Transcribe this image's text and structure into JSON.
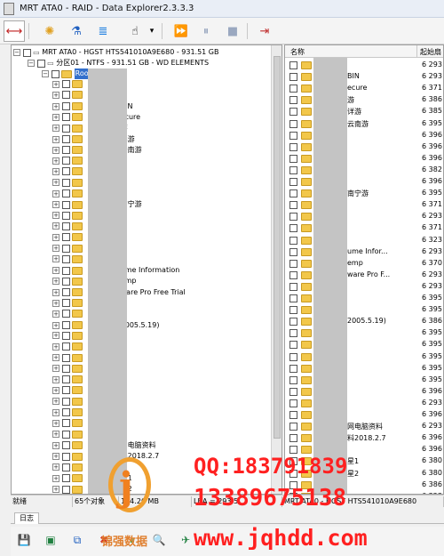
{
  "window": {
    "title": "MRT ATA0 - RAID - Data Explorer2.3.3.3"
  },
  "toolbar": {
    "buttons": [
      "connect-icon",
      "settings-icon",
      "scan-icon",
      "stats-icon",
      "wizard-icon",
      "dropdown-icon",
      "play-icon",
      "pause-icon",
      "stop-icon",
      "exit-icon"
    ]
  },
  "tree": {
    "disk": "MRT ATA0 - HGST HTS541010A9E680 - 931.51 GB",
    "partition": "分区01 - NTFS - 931.51 GB - WD ELEMENTS",
    "root": "Roo",
    "items": [
      "",
      "",
      "BIN",
      "ecure",
      "游",
      "详游",
      "云南游",
      "",
      "",
      "",
      "",
      "南宁游",
      "",
      "",
      "",
      "",
      "",
      "ume Information",
      "emp",
      "ware Pro Free Trial",
      "",
      "",
      "2005.5.19)",
      "",
      "",
      "",
      "",
      "",
      "",
      "",
      "",
      "",
      "",
      "网电脑资料",
      "料2018.2.7",
      "",
      "星1",
      "星2",
      "",
      ""
    ]
  },
  "list": {
    "col_name": "名称",
    "col_start": "起始扇",
    "rows": [
      {
        "name": "",
        "start": "6 293"
      },
      {
        "name": "BIN",
        "start": "6 293"
      },
      {
        "name": "ecure",
        "start": "6 371"
      },
      {
        "name": "游",
        "start": "6 386"
      },
      {
        "name": "详游",
        "start": "6 385"
      },
      {
        "name": "云南游",
        "start": "6 395"
      },
      {
        "name": "",
        "start": "6 396"
      },
      {
        "name": "",
        "start": "6 396"
      },
      {
        "name": "",
        "start": "6 396"
      },
      {
        "name": "",
        "start": "6 382"
      },
      {
        "name": "",
        "start": "6 396"
      },
      {
        "name": "南宁游",
        "start": "6 395"
      },
      {
        "name": "",
        "start": "6 371"
      },
      {
        "name": "",
        "start": "6 293"
      },
      {
        "name": "",
        "start": "6 371"
      },
      {
        "name": "",
        "start": "6 323"
      },
      {
        "name": "ume Infor...",
        "start": "6 293"
      },
      {
        "name": "emp",
        "start": "6 370"
      },
      {
        "name": "ware Pro F...",
        "start": "6 293"
      },
      {
        "name": "",
        "start": "6 293"
      },
      {
        "name": "",
        "start": "6 395"
      },
      {
        "name": "",
        "start": "6 395"
      },
      {
        "name": "2005.5.19)",
        "start": "6 386"
      },
      {
        "name": "",
        "start": "6 395"
      },
      {
        "name": "",
        "start": "6 395"
      },
      {
        "name": "",
        "start": "6 395"
      },
      {
        "name": "",
        "start": "6 395"
      },
      {
        "name": "",
        "start": "6 395"
      },
      {
        "name": "",
        "start": "6 396"
      },
      {
        "name": "",
        "start": "6 293"
      },
      {
        "name": "",
        "start": "6 396"
      },
      {
        "name": "网电脑资料",
        "start": "6 293"
      },
      {
        "name": "料2018.2.7",
        "start": "6 396"
      },
      {
        "name": "",
        "start": "6 396"
      },
      {
        "name": "星1",
        "start": "6 380"
      },
      {
        "name": "星2",
        "start": "6 380"
      },
      {
        "name": "",
        "start": "6 386"
      },
      {
        "name": "",
        "start": "6 323"
      }
    ]
  },
  "status": {
    "state": "就绪",
    "count": "65个对象",
    "size": "184.26 MB",
    "lba": "LBA = 293 5",
    "device": "MRT ATA0 - HGST HTS541010A9E680"
  },
  "log_tab": "日志",
  "bottom_toolbar": [
    "save-icon",
    "save-as-icon",
    "copy-icon",
    "delete-icon",
    "pause-icon",
    "search-icon",
    "export-icon"
  ],
  "watermark": {
    "brand": "锦强数据",
    "qq": "QQ:183791839",
    "phone": "13389675138",
    "url": "www.jqhdd.com",
    "colors": {
      "red": "#ff2020",
      "orange": "#f08020"
    }
  }
}
